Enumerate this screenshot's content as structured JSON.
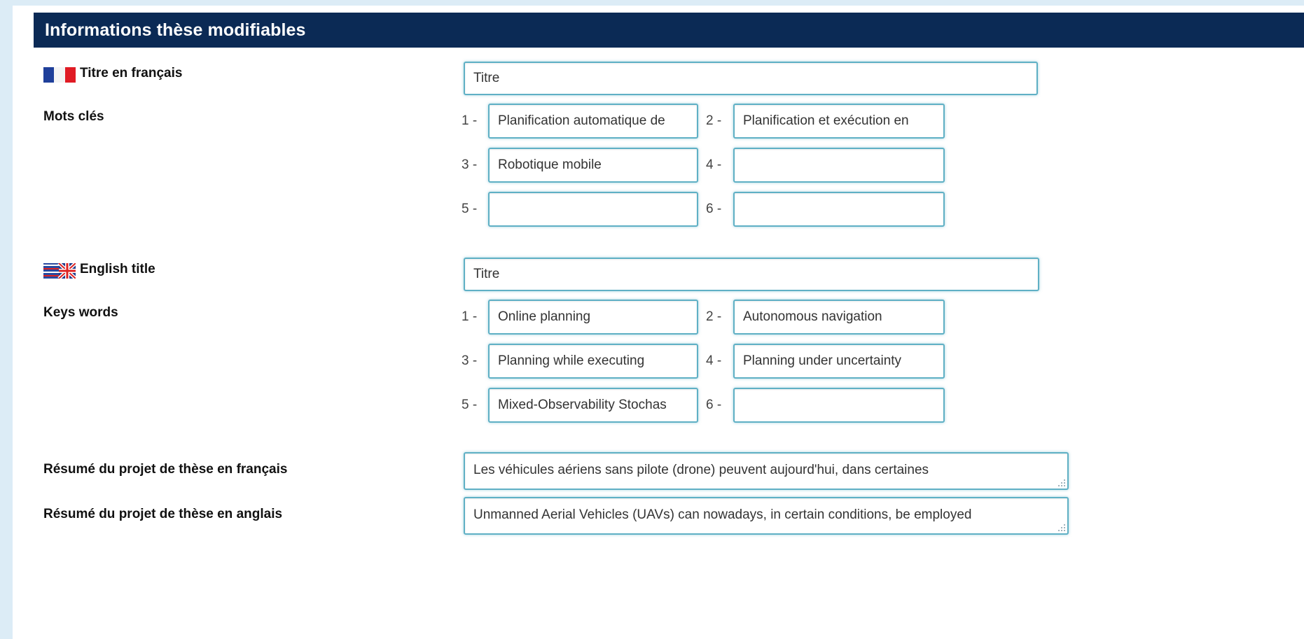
{
  "section": {
    "title": "Informations thèse modifiables"
  },
  "french": {
    "title_label": "Titre en français",
    "title_value": "Titre",
    "keywords_label": "Mots clés",
    "keywords": [
      {
        "num": "1 -",
        "value": "Planification automatique de"
      },
      {
        "num": "2 -",
        "value": "Planification et exécution en"
      },
      {
        "num": "3 -",
        "value": "Robotique mobile"
      },
      {
        "num": "4 -",
        "value": ""
      },
      {
        "num": "5 -",
        "value": ""
      },
      {
        "num": "6 -",
        "value": ""
      }
    ]
  },
  "english": {
    "title_label": "English title",
    "title_value": "Titre",
    "keywords_label": "Keys words",
    "keywords": [
      {
        "num": "1 -",
        "value": "Online planning"
      },
      {
        "num": "2 -",
        "value": "Autonomous navigation"
      },
      {
        "num": "3 -",
        "value": "Planning while executing"
      },
      {
        "num": "4 -",
        "value": "Planning under uncertainty"
      },
      {
        "num": "5 -",
        "value": "Mixed-Observability Stochas"
      },
      {
        "num": "6 -",
        "value": ""
      }
    ]
  },
  "abstracts": {
    "fr_label": "Résumé du projet de thèse en français",
    "fr_value": "Les véhicules aériens sans pilote (drone) peuvent aujourd'hui, dans certaines",
    "en_label": "Résumé du projet de thèse en anglais",
    "en_value": "Unmanned Aerial Vehicles (UAVs) can nowadays, in certain conditions, be employed"
  },
  "icons": {
    "fr_flag": "french-flag-icon",
    "uk_flag": "uk-flag-icon",
    "resize": "resize-grip-icon"
  },
  "colors": {
    "header_bg": "#0b2a55",
    "input_border": "#5fb0c5",
    "fr_blue": "#1f3f9a",
    "fr_red": "#e01b24"
  }
}
